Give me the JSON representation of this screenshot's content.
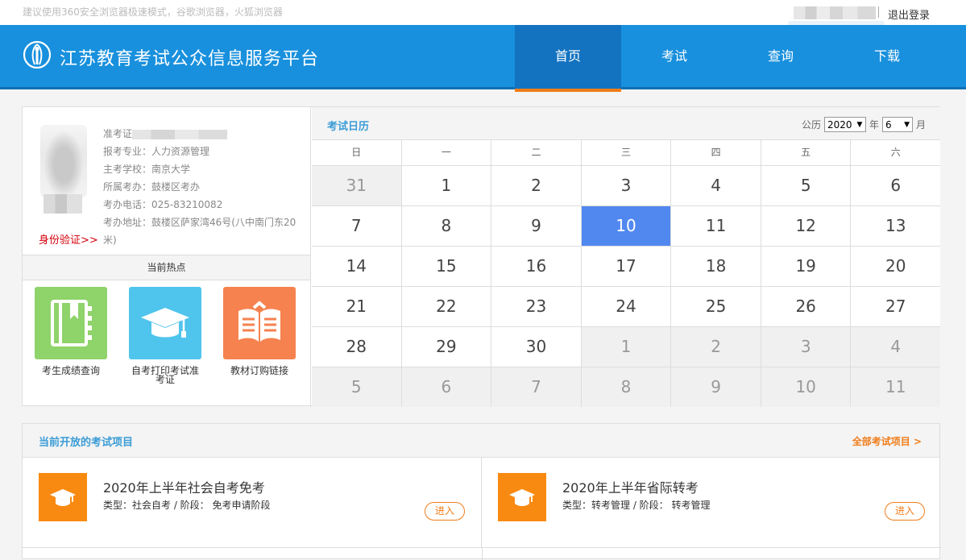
{
  "topbar": {
    "tip": "建议使用360安全浏览器极速模式，谷歌浏览器，火狐浏览器",
    "logout": "退出登录"
  },
  "header": {
    "site_title": "江苏教育考试公众信息服务平台",
    "nav": [
      "首页",
      "考试",
      "查询",
      "下载"
    ],
    "active_nav": "首页"
  },
  "profile": {
    "id_verify": "身份验证>>",
    "fields": [
      {
        "label": "准考证",
        "value": ""
      },
      {
        "label": "报考专业：",
        "value": "人力资源管理"
      },
      {
        "label": "主考学校：",
        "value": "南京大学"
      },
      {
        "label": "所属考办：",
        "value": "鼓楼区考办"
      },
      {
        "label": "考办电话：",
        "value": "025-83210082"
      },
      {
        "label": "考办地址：",
        "value": "鼓楼区萨家湾46号(八中南门东20米)"
      }
    ]
  },
  "hot": {
    "title": "当前热点",
    "tiles": [
      {
        "label": "考生成绩查询",
        "icon": "notebook-icon",
        "color": "#8fd36b"
      },
      {
        "label": "自考打印考试准考证",
        "icon": "graduation-cap-icon",
        "color": "#4fc4ec"
      },
      {
        "label": "教材订购链接",
        "icon": "open-book-icon",
        "color": "#f6824f"
      }
    ]
  },
  "calendar": {
    "title": "考试日历",
    "calendar_type": "公历",
    "year": "2020",
    "year_suffix": "年",
    "month": "6",
    "month_suffix": "月",
    "weekdays": [
      "日",
      "一",
      "二",
      "三",
      "四",
      "五",
      "六"
    ],
    "weeks": [
      [
        {
          "d": "31",
          "other": true
        },
        {
          "d": "1"
        },
        {
          "d": "2"
        },
        {
          "d": "3"
        },
        {
          "d": "4"
        },
        {
          "d": "5"
        },
        {
          "d": "6"
        }
      ],
      [
        {
          "d": "7"
        },
        {
          "d": "8"
        },
        {
          "d": "9"
        },
        {
          "d": "10",
          "today": true
        },
        {
          "d": "11"
        },
        {
          "d": "12"
        },
        {
          "d": "13"
        }
      ],
      [
        {
          "d": "14"
        },
        {
          "d": "15"
        },
        {
          "d": "16"
        },
        {
          "d": "17"
        },
        {
          "d": "18"
        },
        {
          "d": "19"
        },
        {
          "d": "20"
        }
      ],
      [
        {
          "d": "21"
        },
        {
          "d": "22"
        },
        {
          "d": "23"
        },
        {
          "d": "24"
        },
        {
          "d": "25"
        },
        {
          "d": "26"
        },
        {
          "d": "27"
        }
      ],
      [
        {
          "d": "28"
        },
        {
          "d": "29"
        },
        {
          "d": "30"
        },
        {
          "d": "1",
          "other": true
        },
        {
          "d": "2",
          "other": true
        },
        {
          "d": "3",
          "other": true
        },
        {
          "d": "4",
          "other": true
        }
      ],
      [
        {
          "d": "5",
          "other": true
        },
        {
          "d": "6",
          "other": true
        },
        {
          "d": "7",
          "other": true
        },
        {
          "d": "8",
          "other": true
        },
        {
          "d": "9",
          "other": true
        },
        {
          "d": "10",
          "other": true
        },
        {
          "d": "11",
          "other": true
        }
      ]
    ]
  },
  "exams": {
    "title": "当前开放的考试项目",
    "all_link": "全部考试项目 >",
    "items": [
      {
        "name": "2020年上半年社会自考免考",
        "meta": "类型：社会自考 / 阶段： 免考申请阶段",
        "enter": "进入",
        "icon": "graduation-cap-icon"
      },
      {
        "name": "2020年上半年省际转考",
        "meta": "类型：转考管理 / 阶段： 转考管理",
        "enter": "进入",
        "icon": "graduation-cap-icon"
      }
    ]
  },
  "colors": {
    "header_blue": "#1890dd",
    "nav_active": "#1373c0",
    "accent_orange": "#f07d1a",
    "today_blue": "#5188f0"
  }
}
